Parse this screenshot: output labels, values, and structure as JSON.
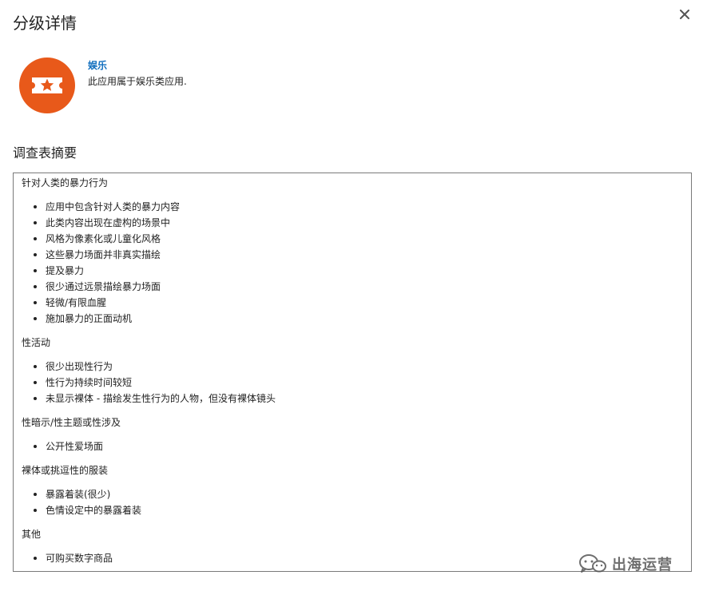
{
  "dialog": {
    "title": "分级详情",
    "close_icon": "close-icon"
  },
  "rating": {
    "icon": "ticket-star-icon",
    "icon_color": "#e8591a",
    "name": "娱乐",
    "description": "此应用属于娱乐类应用."
  },
  "survey": {
    "heading": "调查表摘要",
    "categories": [
      {
        "title": "针对人类的暴力行为",
        "items": [
          "应用中包含针对人类的暴力内容",
          "此类内容出现在虚构的场景中",
          "风格为像素化或儿童化风格",
          "这些暴力场面并非真实描绘",
          "提及暴力",
          "很少通过远景描绘暴力场面",
          "轻微/有限血腥",
          "施加暴力的正面动机"
        ]
      },
      {
        "title": "性活动",
        "items": [
          "很少出现性行为",
          "性行为持续时间较短",
          "未显示裸体 - 描绘发生性行为的人物，但没有裸体镜头"
        ]
      },
      {
        "title": "性暗示/性主题或性涉及",
        "items": [
          "公开性爱场面"
        ]
      },
      {
        "title": "裸体或挑逗性的服装",
        "items": [
          "暴露着装(很少)",
          "色情设定中的暴露着装"
        ]
      },
      {
        "title": "其他",
        "items": [
          "可购买数字商品"
        ]
      }
    ]
  },
  "watermark": {
    "icon": "wechat-icon",
    "text": "出海运营"
  }
}
